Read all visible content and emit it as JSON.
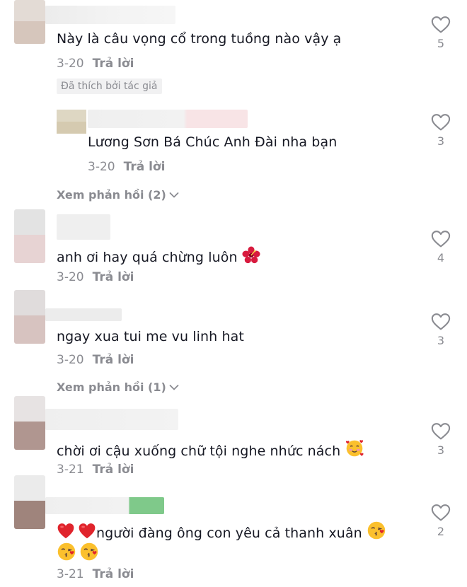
{
  "comments": [
    {
      "text": "Này là câu vọng cổ trong tuồng nào vậy ạ",
      "date": "3-20",
      "reply_label": "Trả lời",
      "badge": "Đã thích bởi tác giả",
      "likes": "5"
    },
    {
      "text": "Lương Sơn Bá Chúc Anh Đài nha bạn",
      "date": "3-20",
      "reply_label": "Trả lời",
      "likes": "3"
    },
    {
      "view_replies": "Xem phản hồi (2)"
    },
    {
      "text": "anh ơi hay quá chừng luôn",
      "date": "3-20",
      "reply_label": "Trả lời",
      "likes": "4"
    },
    {
      "text": "ngay xua tui me vu linh hat",
      "date": "3-20",
      "reply_label": "Trả lời",
      "likes": "3",
      "view_replies": "Xem phản hồi (1)"
    },
    {
      "text": "chời ơi cậu xuống chữ tội nghe nhức nách",
      "date": "3-21",
      "reply_label": "Trả lời",
      "likes": "3"
    },
    {
      "text": "người đàng ông con yêu cả thanh xuân",
      "date": "3-21",
      "reply_label": "Trả lời",
      "likes": "2"
    }
  ],
  "icons": {
    "like": "heart-outline-icon",
    "expand": "chevron-down-icon",
    "hibiscus": "hibiscus-emoji",
    "smiling_hearts": "smiling-face-with-hearts-emoji",
    "red_heart": "red-heart-emoji",
    "kiss": "face-blowing-kiss-emoji"
  },
  "colors": {
    "text": "#161823",
    "meta": "#8a8b91",
    "badge_bg": "#f1f1f2"
  }
}
